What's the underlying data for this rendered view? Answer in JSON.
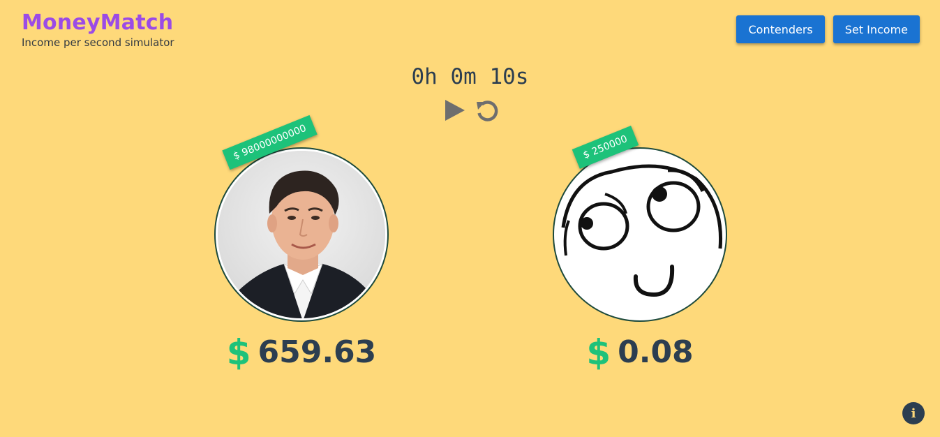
{
  "brand": {
    "title": "MoneyMatch",
    "subtitle": "Income per second simulator"
  },
  "toolbar": {
    "contenders_label": "Contenders",
    "set_income_label": "Set Income"
  },
  "timer": {
    "display": "0h 0m 10s",
    "play_icon": "play-icon",
    "reset_icon": "reset-icon"
  },
  "contenders": [
    {
      "income_tag": "$ 98000000000",
      "earned_currency": "$",
      "earned_amount": "659.63",
      "avatar": "photo of man in dark suit"
    },
    {
      "income_tag": "$ 250000",
      "earned_currency": "$",
      "earned_amount": "0.08",
      "avatar": "cartoon derp face"
    }
  ],
  "info": {
    "icon": "info-icon",
    "glyph": "i"
  },
  "colors": {
    "background": "#fed97a",
    "brand": "#9b4be6",
    "button": "#1a73d2",
    "accent_green": "#1dc27a",
    "text_dark": "#2c3e50"
  }
}
